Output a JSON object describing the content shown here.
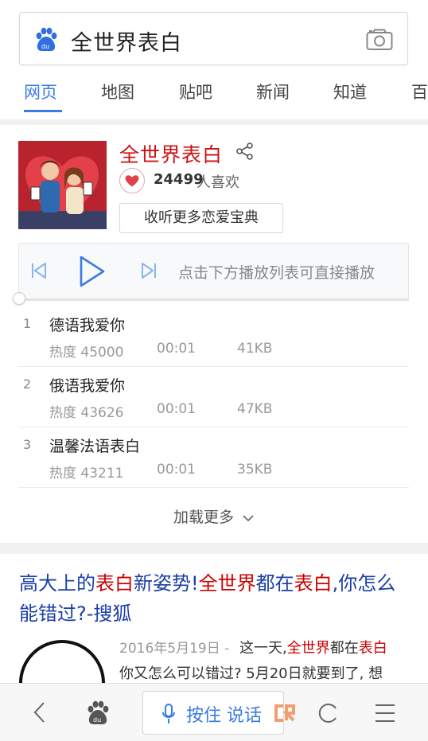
{
  "search": {
    "query": "全世界表白"
  },
  "tabs": [
    "网页",
    "地图",
    "贴吧",
    "新闻",
    "知道",
    "百"
  ],
  "music": {
    "title": "全世界表白",
    "likes": "24499",
    "likes_unit": "人喜欢",
    "more_button": "收听更多恋爱宝典",
    "player_hint": "点击下方播放列表可直接播放",
    "tracks": [
      {
        "num": "1",
        "name": "德语我爱你",
        "heat": "热度 45000",
        "duration": "00:01",
        "size": "41KB"
      },
      {
        "num": "2",
        "name": "俄语我爱你",
        "heat": "热度 43626",
        "duration": "00:01",
        "size": "47KB"
      },
      {
        "num": "3",
        "name": "温馨法语表白",
        "heat": "热度 43211",
        "duration": "00:01",
        "size": "35KB"
      }
    ],
    "load_more": "加载更多"
  },
  "result": {
    "title_parts": [
      "高大上的",
      "表白",
      "新姿势!",
      "全世界",
      "都在",
      "表白",
      ",你怎么能错过?-搜狐"
    ],
    "date": "2016年5月19日 -",
    "snippet_a": "这一天,",
    "snippet_hl1": "全世界",
    "snippet_b": "都在",
    "snippet_hl2": "表白",
    "snippet_line2": "你又怎么可以错过? 5月20日就要到了, 想"
  },
  "bottom": {
    "voice_label": "按住 说话"
  },
  "colors": {
    "accent": "#3a7be4",
    "highlight": "#cc1111",
    "link": "#1a3fa8"
  }
}
